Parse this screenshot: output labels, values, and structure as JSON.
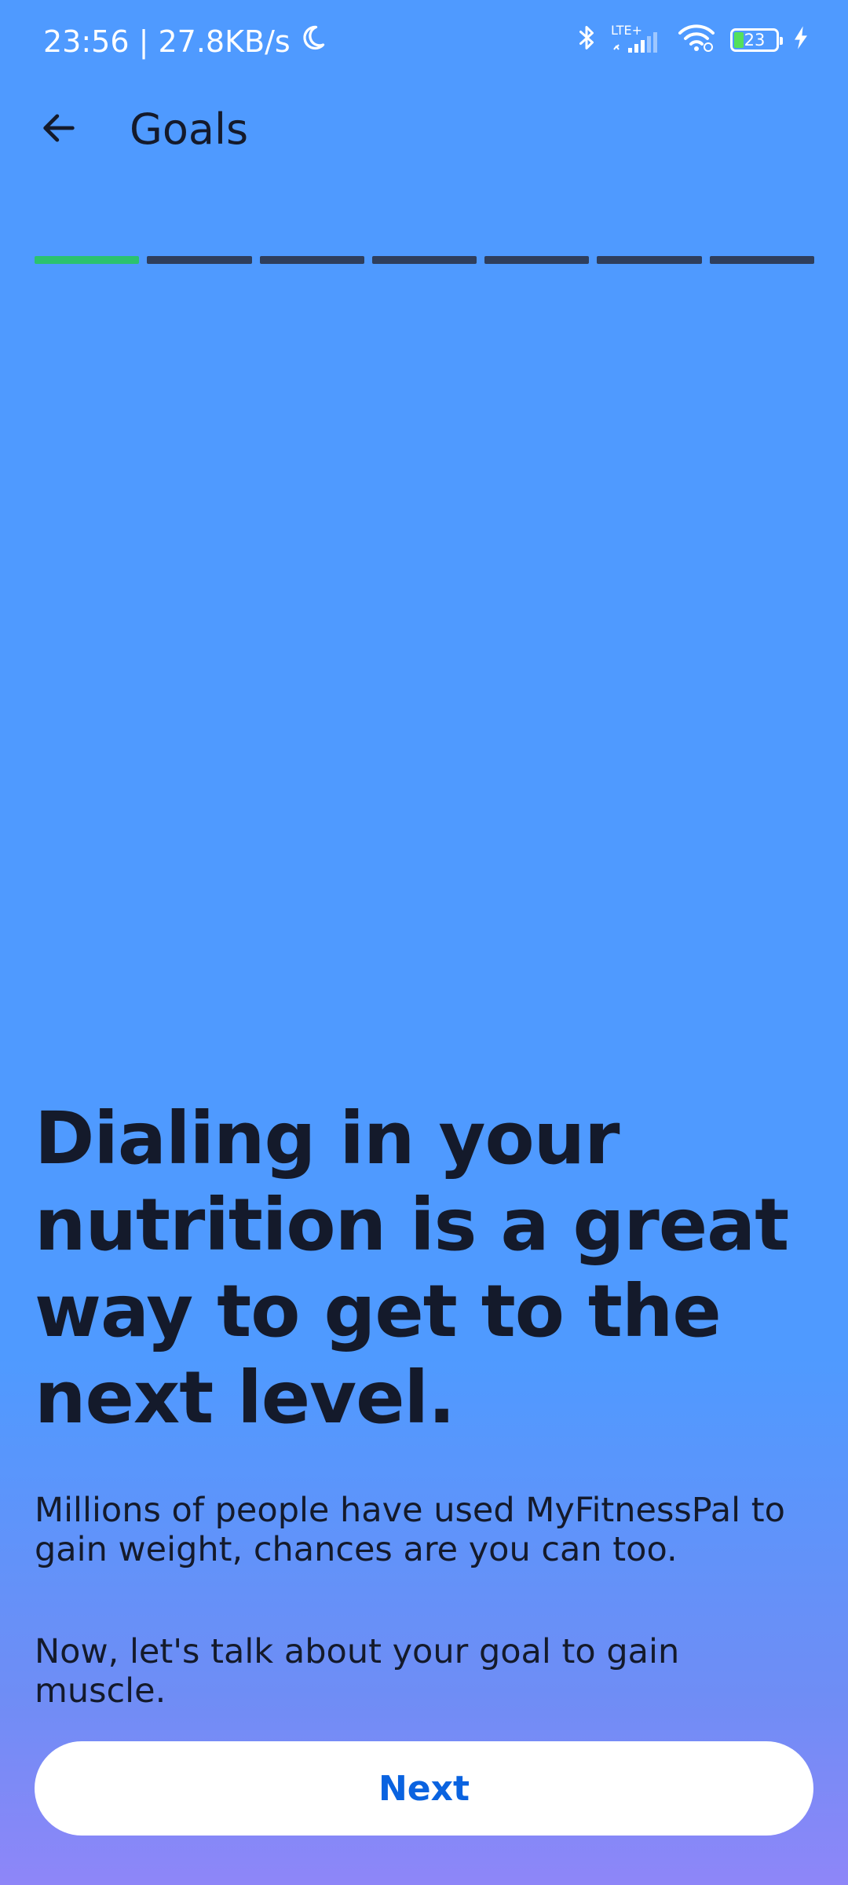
{
  "status_bar": {
    "time_speed": "23:56 | 27.8KB/s",
    "network_label": "LTE+",
    "battery_level": "23",
    "icons": [
      "moon-icon",
      "bluetooth-icon",
      "signal-icon",
      "wifi-icon",
      "battery-icon",
      "charging-icon"
    ]
  },
  "app_bar": {
    "title": "Goals",
    "back_icon": "arrow-left-icon"
  },
  "progress": {
    "total_steps": 7,
    "completed_steps": 1,
    "done_color": "#2bc26f",
    "pending_color": "#2e3e5c"
  },
  "content": {
    "headline": "Dialing in your nutrition is a great way to get to the next level.",
    "paragraph_1": "Millions of people have used MyFitnessPal to gain weight, chances are you can too.",
    "paragraph_2": "Now, let's talk about your goal to gain muscle."
  },
  "actions": {
    "next_label": "Next"
  },
  "colors": {
    "background": "#4f9aff",
    "background_bottom": "#8e86f8",
    "text": "#141a2b",
    "button_text": "#0a63e0"
  }
}
